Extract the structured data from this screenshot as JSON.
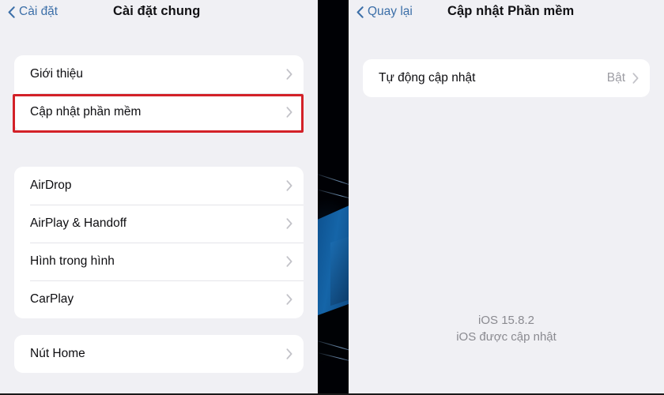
{
  "left_panel": {
    "navbar": {
      "back_label": "Cài đặt",
      "title": "Cài đặt chung",
      "back_icon": "chevron-left-icon"
    },
    "groups": [
      {
        "rows": [
          {
            "label": "Giới thiệu",
            "accessory": "chevron-right-icon"
          },
          {
            "label": "Cập nhật phần mềm",
            "accessory": "chevron-right-icon",
            "highlighted": true
          }
        ]
      },
      {
        "rows": [
          {
            "label": "AirDrop",
            "accessory": "chevron-right-icon"
          },
          {
            "label": "AirPlay & Handoff",
            "accessory": "chevron-right-icon"
          },
          {
            "label": "Hình trong hình",
            "accessory": "chevron-right-icon"
          },
          {
            "label": "CarPlay",
            "accessory": "chevron-right-icon"
          }
        ]
      },
      {
        "rows": [
          {
            "label": "Nút Home",
            "accessory": "chevron-right-icon"
          }
        ]
      }
    ]
  },
  "right_panel": {
    "navbar": {
      "back_label": "Quay lại",
      "title": "Cập nhật Phần mềm",
      "back_icon": "chevron-left-icon"
    },
    "groups": [
      {
        "rows": [
          {
            "label": "Tự động cập nhật",
            "value": "Bật",
            "accessory": "chevron-right-icon"
          }
        ]
      }
    ],
    "version": {
      "number": "iOS 15.8.2",
      "status": "iOS được cập nhật"
    }
  },
  "colors": {
    "accent_blue": "#3c6fa8",
    "highlight_red": "#d32128",
    "page_background": "#f0f0f4",
    "card_background": "#ffffff",
    "primary_text": "#0d0d10",
    "secondary_text": "#9c9ca3",
    "wallpaper_dark": "#000105",
    "wallpaper_blue": "#1565a8"
  }
}
